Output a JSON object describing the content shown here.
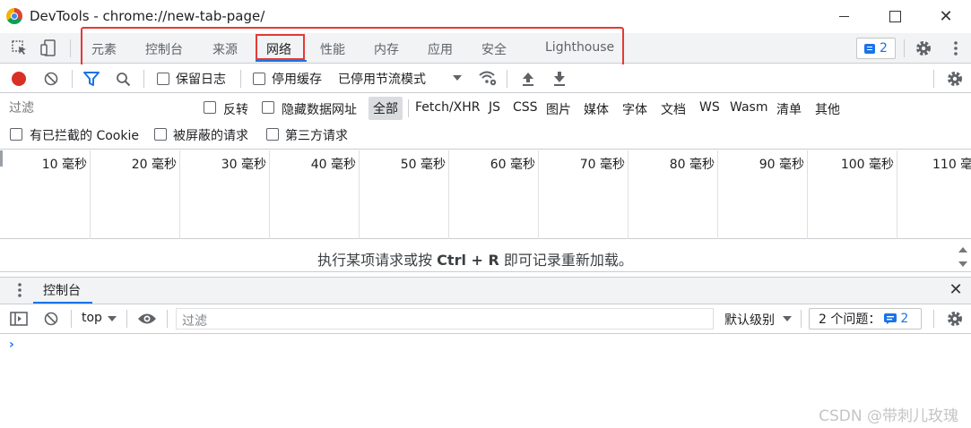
{
  "window": {
    "title": "DevTools - chrome://new-tab-page/"
  },
  "tabs": [
    "元素",
    "控制台",
    "来源",
    "网络",
    "性能",
    "内存",
    "应用",
    "安全",
    "Lighthouse"
  ],
  "issues_count": "2",
  "toolbar": {
    "preserve_log": "保留日志",
    "disable_cache": "停用缓存",
    "throttle": "已停用节流模式"
  },
  "filter": {
    "placeholder": "过滤",
    "invert": "反转",
    "hide_data_urls": "隐藏数据网址",
    "all": "全部",
    "types": [
      "Fetch/XHR",
      "JS",
      "CSS",
      "图片",
      "媒体",
      "字体",
      "文档",
      "WS",
      "Wasm",
      "清单",
      "其他"
    ],
    "blocked_cookies": "有已拦截的 Cookie",
    "blocked_requests": "被屏蔽的请求",
    "third_party": "第三方请求"
  },
  "timeline_ticks": [
    "10 毫秒",
    "20 毫秒",
    "30 毫秒",
    "40 毫秒",
    "50 毫秒",
    "60 毫秒",
    "70 毫秒",
    "80 毫秒",
    "90 毫秒",
    "100 毫秒",
    "110 毫"
  ],
  "empty_message": {
    "before": "执行某项请求或按 ",
    "shortcut": "Ctrl + R",
    "after": " 即可记录重新加载。"
  },
  "drawer": {
    "tab": "控制台",
    "context": "top",
    "filter_placeholder": "过滤",
    "levels": "默认级别",
    "issues_label": "2 个问题：",
    "issues_count": "2"
  },
  "prompt_symbol": "›",
  "watermark": "CSDN @带刺儿玫瑰",
  "colors": {
    "accent": "#1a73e8",
    "record": "#d93025",
    "highlight": "#e53935"
  }
}
